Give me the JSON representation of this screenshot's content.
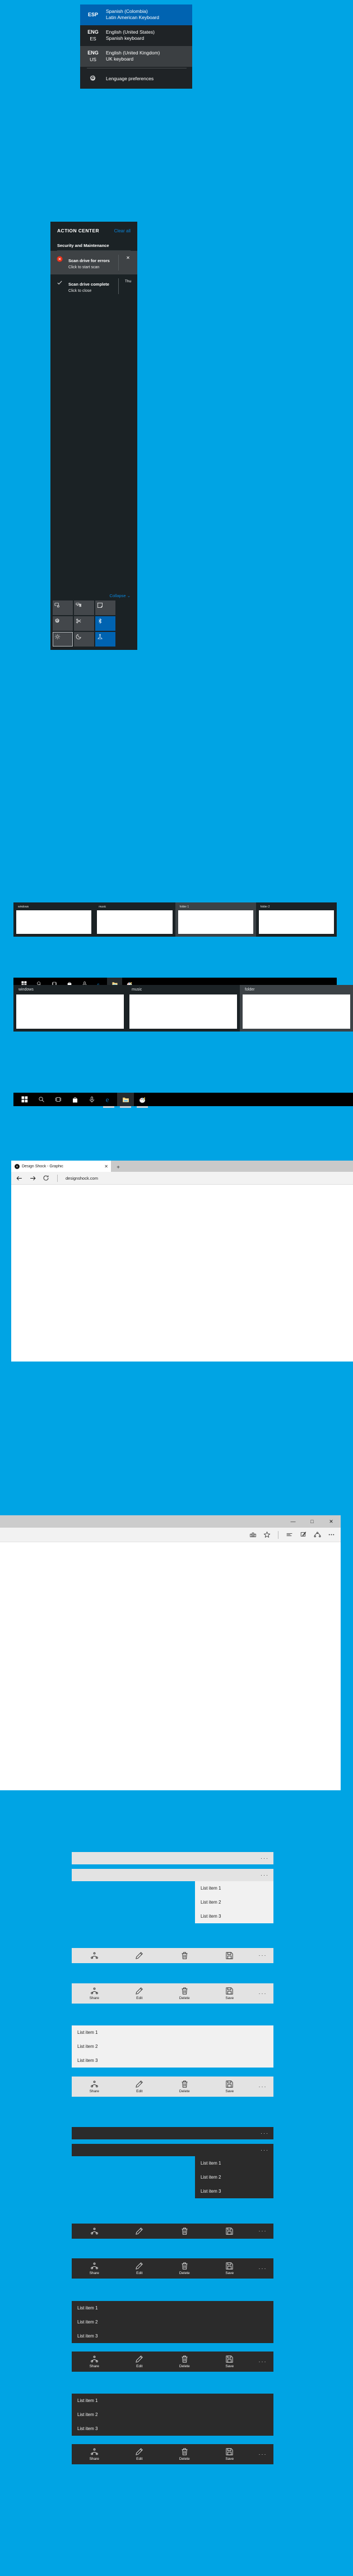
{
  "theme": {
    "desktop_background": "#00a4e4",
    "accent": "#0063b1",
    "dark_panel": "#1b2225",
    "link_blue": "#0a84d8",
    "error_red": "#e8311a"
  },
  "language_flyout": {
    "items": [
      {
        "code": "ESP",
        "sub": "",
        "name": "Spanish (Colombia)",
        "layout": "Latin American Keyboard",
        "state": "selected"
      },
      {
        "code": "ENG",
        "sub": "ES",
        "name": "English (United States)",
        "layout": "Spanish keyboard",
        "state": "normal"
      },
      {
        "code": "ENG",
        "sub": "US",
        "name": "English (United Kingdom)",
        "layout": "UK keyboard",
        "state": "hover"
      }
    ],
    "preferences_label": "Lenguage preferences",
    "preferences_icon": "gear-icon"
  },
  "action_center": {
    "title": "ACTION CENTER",
    "clear_all": "Clear all",
    "group_title": "Security and Maintenance",
    "notifications": [
      {
        "icon": "error-circle-icon",
        "title": "Scan drive for errors",
        "subtitle": "Click to start scan",
        "action": "✕",
        "state": "hover"
      },
      {
        "icon": "checkmark-icon",
        "title": "Scan drive complete",
        "subtitle": "Click to close",
        "action": "Thu",
        "state": "normal"
      }
    ],
    "collapse_label": "Collapse",
    "collapse_icon": "chevron-down-icon",
    "quick_actions": [
      {
        "name": "tablet-mode-icon",
        "state": "off"
      },
      {
        "name": "connect-icon",
        "state": "off"
      },
      {
        "name": "note-icon",
        "state": "off"
      },
      {
        "name": "all-settings-icon",
        "state": "off"
      },
      {
        "name": "vpn-icon",
        "state": "off"
      },
      {
        "name": "bluetooth-icon",
        "state": "on"
      },
      {
        "name": "brightness-icon",
        "state": "focus"
      },
      {
        "name": "quiet-hours-icon",
        "state": "off"
      },
      {
        "name": "location-icon",
        "state": "on"
      }
    ]
  },
  "task_view_small": {
    "cards": [
      {
        "label": "windows",
        "state": "normal"
      },
      {
        "label": "music",
        "state": "normal"
      },
      {
        "label": "folder 1",
        "state": "active"
      },
      {
        "label": "folder 2",
        "state": "normal"
      }
    ],
    "taskbar": [
      {
        "name": "start-icon",
        "state": "normal"
      },
      {
        "name": "search-icon",
        "state": "normal"
      },
      {
        "name": "task-view-icon",
        "state": "normal"
      },
      {
        "name": "store-icon",
        "state": "normal"
      },
      {
        "name": "cortana-mic-icon",
        "state": "normal"
      },
      {
        "name": "edge-icon",
        "state": "running"
      },
      {
        "name": "file-explorer-icon",
        "state": "active"
      },
      {
        "name": "paint-icon",
        "state": "running"
      }
    ]
  },
  "task_view_large": {
    "cards": [
      {
        "label": "windows",
        "state": "normal"
      },
      {
        "label": "music",
        "state": "normal"
      },
      {
        "label": "folder",
        "state": "active"
      }
    ],
    "taskbar": [
      {
        "name": "start-icon",
        "state": "normal"
      },
      {
        "name": "search-icon",
        "state": "normal"
      },
      {
        "name": "task-view-icon",
        "state": "normal"
      },
      {
        "name": "store-icon",
        "state": "normal"
      },
      {
        "name": "cortana-mic-icon",
        "state": "normal"
      },
      {
        "name": "edge-icon",
        "state": "running"
      },
      {
        "name": "file-explorer-icon",
        "state": "active"
      },
      {
        "name": "paint-icon",
        "state": "running"
      }
    ]
  },
  "browser_window": {
    "tab_title": "Design Shock - Graphic",
    "tab_close": "✕",
    "new_tab": "+",
    "back_icon": "back-arrow-icon",
    "forward_icon": "forward-arrow-icon",
    "refresh_icon": "refresh-icon",
    "url": "designshock.com"
  },
  "edge_window": {
    "minimize": "—",
    "maximize": "□",
    "close": "✕",
    "toolbar_icons": [
      "reading-view-icon",
      "favorites-star-icon",
      "hub-icon",
      "web-note-icon",
      "share-icon",
      "more-icon"
    ]
  },
  "controls": {
    "list_items": [
      "List item 1",
      "List item 2",
      "List item 3"
    ],
    "overflow_dots": "···",
    "commands": [
      {
        "label": "Share",
        "icon": "share-icon"
      },
      {
        "label": "Edit",
        "icon": "pencil-icon"
      },
      {
        "label": "Delete",
        "icon": "trash-icon"
      },
      {
        "label": "Save",
        "icon": "save-icon"
      }
    ],
    "sections": [
      {
        "theme": "light",
        "kind": "appbar-flyout"
      },
      {
        "theme": "light",
        "kind": "commandbar-icons"
      },
      {
        "theme": "light",
        "kind": "commandbar-labels"
      },
      {
        "theme": "light",
        "kind": "listview"
      },
      {
        "theme": "dark",
        "kind": "appbar-flyout"
      },
      {
        "theme": "dark",
        "kind": "commandbar-icons"
      },
      {
        "theme": "dark",
        "kind": "commandbar-labels"
      },
      {
        "theme": "dark",
        "kind": "listview"
      }
    ]
  }
}
